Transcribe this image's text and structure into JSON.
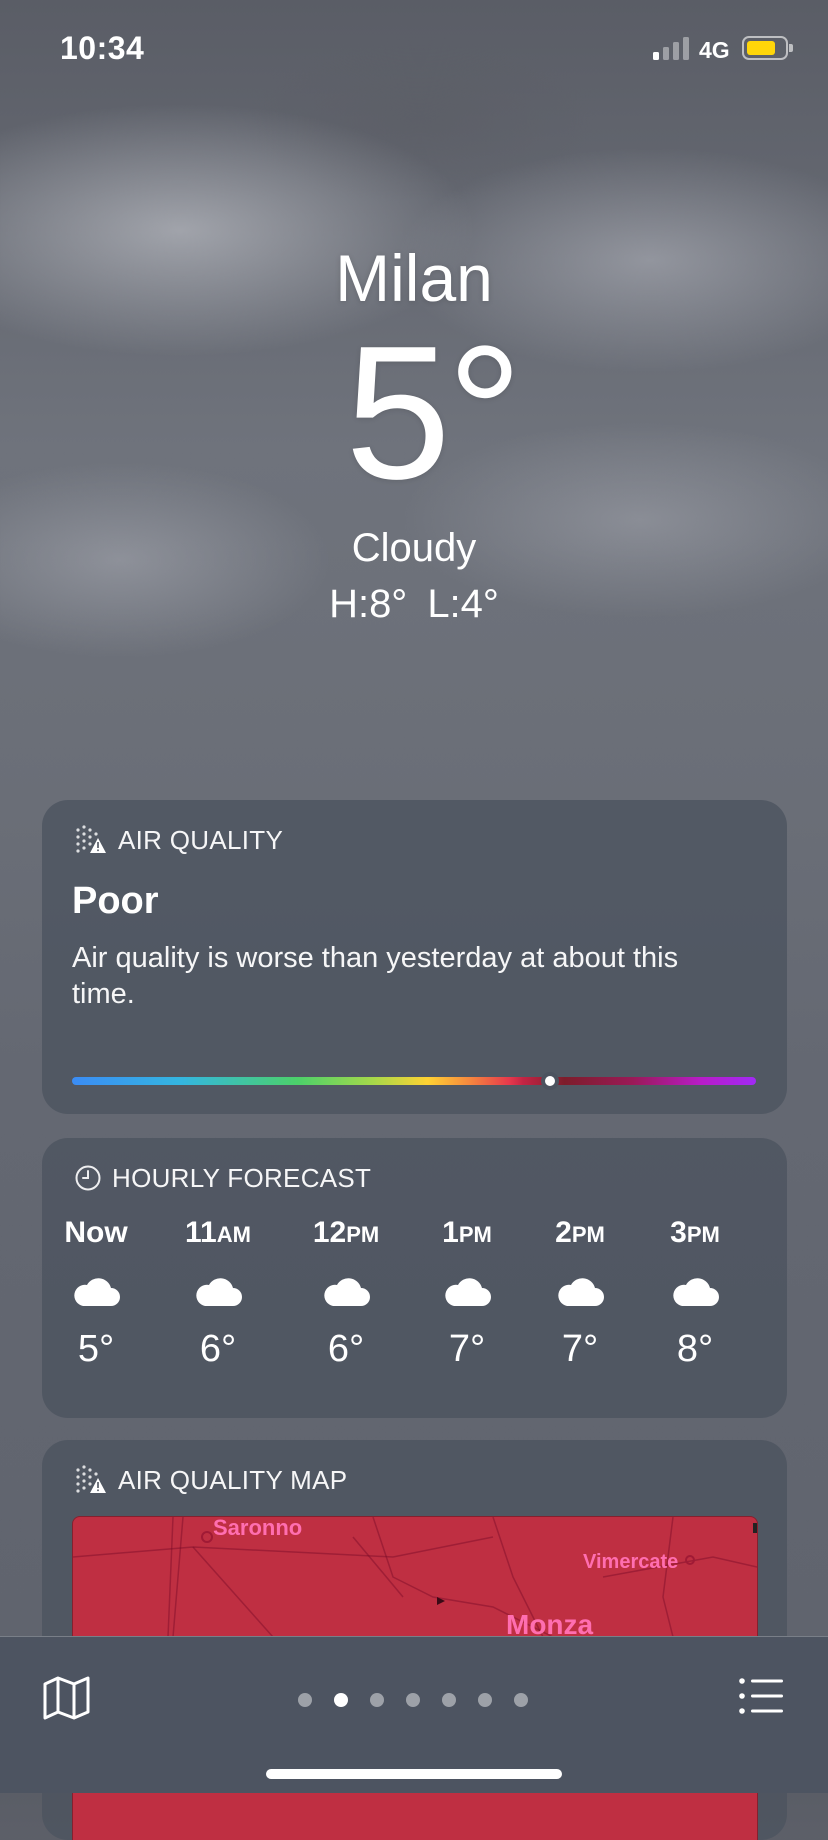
{
  "status": {
    "time": "10:34",
    "network": "4G",
    "signal_bars": 1,
    "battery_color": "#ffd60a"
  },
  "weather": {
    "city": "Milan",
    "temp": "5°",
    "condition": "Cloudy",
    "high": "H:8°",
    "low": "L:4°"
  },
  "air_quality": {
    "title": "AIR QUALITY",
    "level": "Poor",
    "description": "Air quality is worse than yesterday at about this time.",
    "icon": "air-quality-warning-icon",
    "scale_position": 0.65
  },
  "hourly": {
    "title": "HOURLY FORECAST",
    "icon": "clock-icon",
    "hours": [
      {
        "label": "Now",
        "suffix": "",
        "temp": "5°",
        "icon": "cloud-icon"
      },
      {
        "label": "11",
        "suffix": "AM",
        "temp": "6°",
        "icon": "cloud-icon"
      },
      {
        "label": "12",
        "suffix": "PM",
        "temp": "6°",
        "icon": "cloud-icon"
      },
      {
        "label": "1",
        "suffix": "PM",
        "temp": "7°",
        "icon": "cloud-icon"
      },
      {
        "label": "2",
        "suffix": "PM",
        "temp": "7°",
        "icon": "cloud-icon"
      },
      {
        "label": "3",
        "suffix": "PM",
        "temp": "8°",
        "icon": "cloud-icon"
      }
    ]
  },
  "aq_map": {
    "title": "AIR QUALITY MAP",
    "icon": "air-quality-warning-icon",
    "places": {
      "saronno": "Saronno",
      "vimercate": "Vimercate",
      "monza": "Monza"
    },
    "map_color": "#bf2f42"
  },
  "tabbar": {
    "map_icon": "map-icon",
    "list_icon": "list-icon",
    "page_count": 7,
    "active_page": 2
  }
}
